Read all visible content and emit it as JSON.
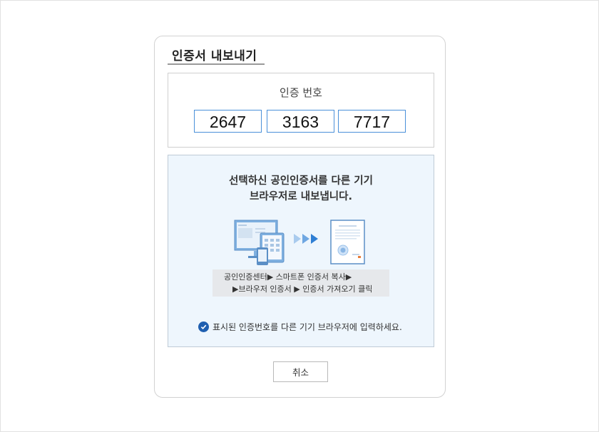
{
  "dialog": {
    "title": "인증서 내보내기",
    "code_section": {
      "label": "인증 번호",
      "codes": [
        "2647",
        "3163",
        "7717"
      ]
    },
    "info": {
      "heading_line1": "선택하신 공인인증서를 다른 기기",
      "heading_line2": "브라우저로 내보냅니다.",
      "steps_line1": "공인인증센터▶ 스마트폰 인증서 복사▶",
      "steps_line2": "▶브라우저 인증서 ▶ 인증서 가져오기 클릭",
      "notice": "표시된 인증번호를 다른 기기 브라우저에 입력하세요."
    },
    "cancel_label": "취소"
  },
  "colors": {
    "accent": "#4a90d9",
    "info_bg": "#eef6fd",
    "check": "#1f5fb0"
  },
  "icons": {
    "illustration": "devices-to-certificate-illustration",
    "notice": "check-circle-icon"
  }
}
